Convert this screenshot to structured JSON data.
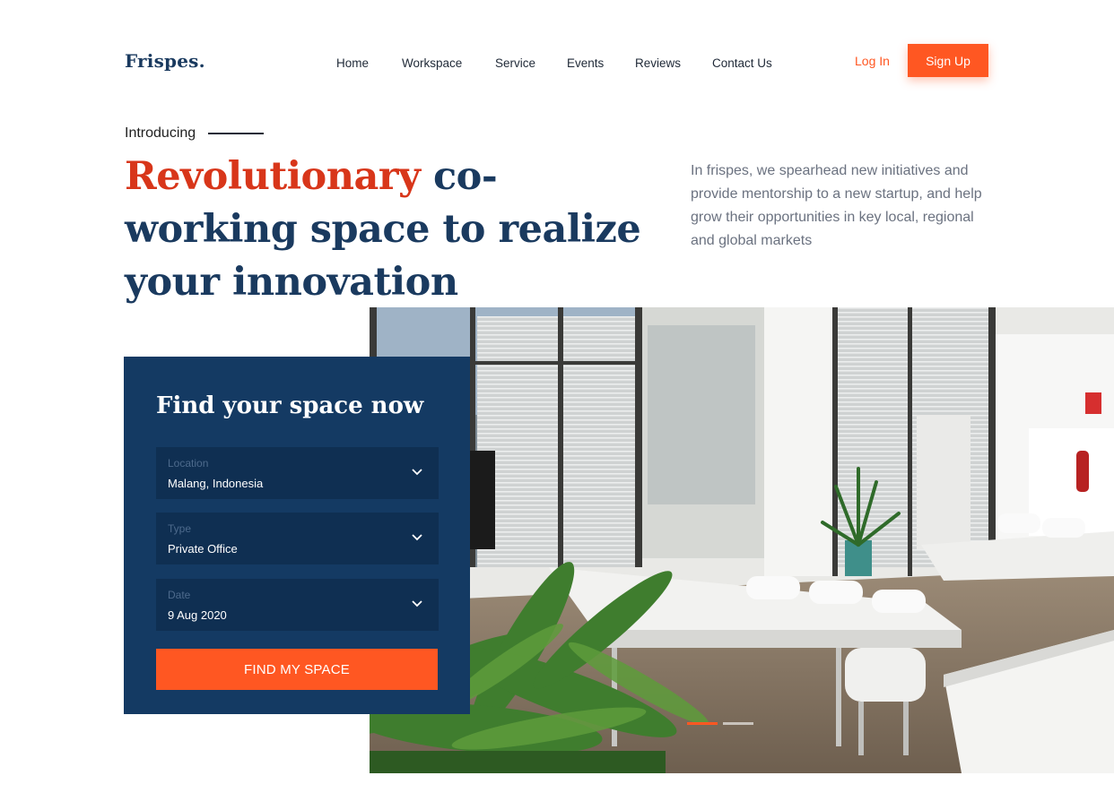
{
  "brand": {
    "logo": "Frispes."
  },
  "nav": {
    "items": [
      {
        "label": "Home"
      },
      {
        "label": "Workspace"
      },
      {
        "label": "Service"
      },
      {
        "label": "Events"
      },
      {
        "label": "Reviews"
      },
      {
        "label": "Contact Us"
      }
    ],
    "login_label": "Log In",
    "signup_label": "Sign Up"
  },
  "hero": {
    "intro": "Introducing",
    "headline_accent": "Revolutionary",
    "headline_rest": "co-working space to realize your innovation",
    "description": "In frispes, we spearhead new initiatives and provide mentorship to a new startup, and help grow their opportunities in key local, regional and global markets"
  },
  "search": {
    "title": "Find your space now",
    "fields": [
      {
        "label": "Location",
        "value": "Malang, Indonesia",
        "icon": "chevron-down-icon"
      },
      {
        "label": "Type",
        "value": "Private Office",
        "icon": "chevron-down-icon"
      },
      {
        "label": "Date",
        "value": "9 Aug 2020",
        "icon": "chevron-down-icon"
      }
    ],
    "button_label": "FIND MY SPACE"
  },
  "carousel": {
    "total": 2,
    "active": 1
  },
  "colors": {
    "accent": "#ff5722",
    "headline_accent": "#d8361a",
    "navy": "#1a3a5f",
    "card_bg": "#143a63",
    "field_bg": "#0f2f52"
  }
}
